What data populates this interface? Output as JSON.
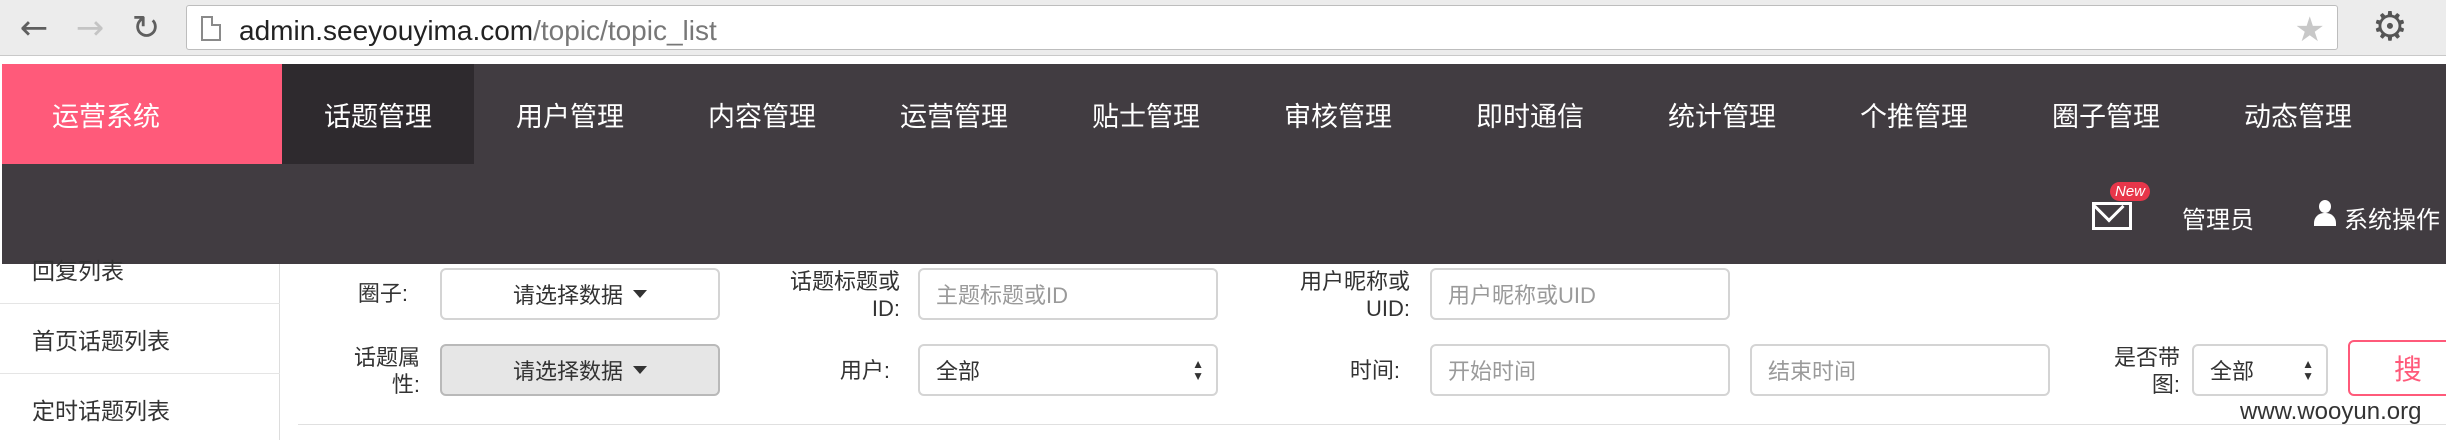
{
  "browser": {
    "url_domain": "admin.seeyouyima.com",
    "url_path": "/topic/topic_list"
  },
  "header": {
    "brand": "运营系统",
    "menu": [
      "话题管理",
      "用户管理",
      "内容管理",
      "运营管理",
      "贴士管理",
      "审核管理",
      "即时通信",
      "统计管理",
      "个推管理",
      "圈子管理",
      "动态管理"
    ],
    "new_badge": "New",
    "admin": "管理员",
    "system_ops": "系统操作"
  },
  "sidebar": {
    "items": [
      "回复列表",
      "首页话题列表",
      "定时话题列表"
    ]
  },
  "filters": {
    "circle_label": "圈子:",
    "circle_value": "请选择数据",
    "topic_title_label_1": "话题标题或",
    "topic_title_label_2": "ID:",
    "topic_title_placeholder": "主题标题或ID",
    "nickname_label_1": "用户昵称或",
    "nickname_label_2": "UID:",
    "nickname_placeholder": "用户昵称或UID",
    "attr_label_1": "话题属",
    "attr_label_2": "性:",
    "attr_value": "请选择数据",
    "user_label": "用户:",
    "user_value": "全部",
    "time_label": "时间:",
    "start_placeholder": "开始时间",
    "end_placeholder": "结束时间",
    "with_image_label_1": "是否带",
    "with_image_label_2": "图:",
    "with_image_value": "全部",
    "search_button": "搜"
  },
  "watermark": "www.wooyun.org"
}
